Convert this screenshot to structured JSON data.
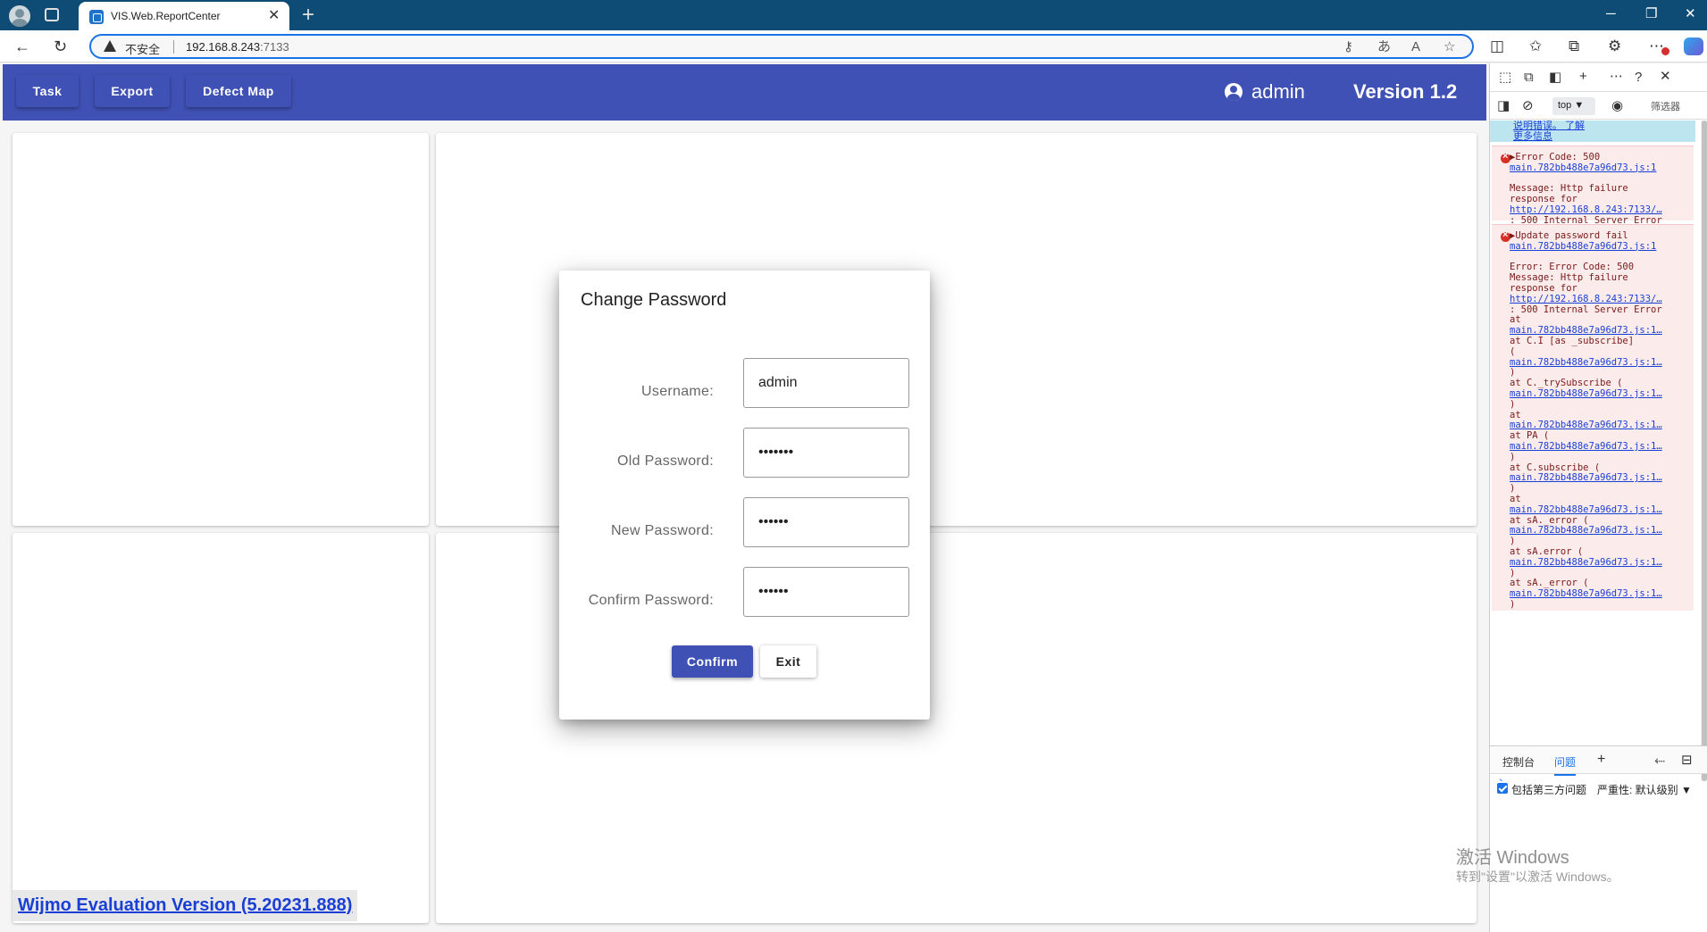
{
  "browser": {
    "tab_title": "VIS.Web.ReportCenter",
    "tab_close": "✕",
    "new_tab": "+",
    "win_min": "─",
    "win_max": "❐",
    "win_close": "✕",
    "insecure_label": "不安全",
    "url_host": "192.168.8.243",
    "url_port": ":7133",
    "icons": [
      "back-icon",
      "refresh-icon",
      "warning-icon",
      "key-icon",
      "translate-icon",
      "read-aloud-icon",
      "favorite-icon",
      "split-screen-icon",
      "favorites-icon",
      "collections-icon",
      "extensions-icon",
      "more-icon",
      "copilot-icon"
    ]
  },
  "app": {
    "nav": [
      {
        "label": "Task"
      },
      {
        "label": "Export"
      },
      {
        "label": "Defect Map"
      }
    ],
    "user": "admin",
    "version": "Version 1.2",
    "wijmo_link": "Wijmo Evaluation Version (5.20231.888)",
    "colors": {
      "primary": "#3f51b5",
      "link": "#1a3fd6"
    }
  },
  "modal": {
    "title": "Change Password",
    "fields": [
      {
        "label": "Username:",
        "value": "admin",
        "type": "text"
      },
      {
        "label": "Old Password:",
        "value": "•••••••",
        "type": "password"
      },
      {
        "label": "New Password:",
        "value": "••••••",
        "type": "password"
      },
      {
        "label": "Confirm Password:",
        "value": "••••••",
        "type": "password"
      }
    ],
    "confirm_label": "Confirm",
    "exit_label": "Exit"
  },
  "devtools": {
    "context": "top ▼",
    "filter": "筛选器",
    "info_line1": "说明错误。 了解",
    "info_line2": "更多信息",
    "errors": [
      {
        "lines": [
          {
            "text": "▶Error Code: 500",
            "link": false
          },
          {
            "text": " main.782bb488e7a96d73.js:1",
            "link": true
          },
          {
            "text": "",
            "link": false
          },
          {
            "text": "Message: Http failure",
            "link": false
          },
          {
            "text": "response for",
            "link": false
          },
          {
            "text": "http://192.168.8.243:7133/…",
            "link": true
          },
          {
            "text": ": 500 Internal Server Error",
            "link": false
          }
        ]
      },
      {
        "lines": [
          {
            "text": "▶Update password fail",
            "link": false
          },
          {
            "text": " main.782bb488e7a96d73.js:1",
            "link": true
          },
          {
            "text": "",
            "link": false
          },
          {
            "text": "Error: Error Code: 500",
            "link": false
          },
          {
            "text": "Message: Http failure",
            "link": false
          },
          {
            "text": "response for",
            "link": false
          },
          {
            "text": "http://192.168.8.243:7133/…",
            "link": true
          },
          {
            "text": ": 500 Internal Server Error",
            "link": false
          },
          {
            "text": "    at",
            "link": false
          },
          {
            "text": "main.782bb488e7a96d73.js:1…",
            "link": true
          },
          {
            "text": "    at C.I [as _subscribe]",
            "link": false
          },
          {
            "text": "(",
            "link": false
          },
          {
            "text": "main.782bb488e7a96d73.js:1…",
            "link": true
          },
          {
            "text": ")",
            "link": false
          },
          {
            "text": "    at C._trySubscribe (",
            "link": false
          },
          {
            "text": "main.782bb488e7a96d73.js:1…",
            "link": true
          },
          {
            "text": ")",
            "link": false
          },
          {
            "text": "    at",
            "link": false
          },
          {
            "text": "main.782bb488e7a96d73.js:1…",
            "link": true
          },
          {
            "text": "    at PA (",
            "link": false
          },
          {
            "text": "main.782bb488e7a96d73.js:1…",
            "link": true
          },
          {
            "text": ")",
            "link": false
          },
          {
            "text": "    at C.subscribe (",
            "link": false
          },
          {
            "text": "main.782bb488e7a96d73.js:1…",
            "link": true
          },
          {
            "text": ")",
            "link": false
          },
          {
            "text": "    at",
            "link": false
          },
          {
            "text": "main.782bb488e7a96d73.js:1…",
            "link": true
          },
          {
            "text": "    at sA._error (",
            "link": false
          },
          {
            "text": "main.782bb488e7a96d73.js:1…",
            "link": true
          },
          {
            "text": ")",
            "link": false
          },
          {
            "text": "    at sA.error (",
            "link": false
          },
          {
            "text": "main.782bb488e7a96d73.js:1…",
            "link": true
          },
          {
            "text": ")",
            "link": false
          },
          {
            "text": "    at sA._error (",
            "link": false
          },
          {
            "text": "main.782bb488e7a96d73.js:1…",
            "link": true
          },
          {
            "text": ")",
            "link": false
          }
        ]
      }
    ],
    "prompt": "›",
    "drawer_tabs": [
      "控制台",
      "问题"
    ],
    "drawer_add": "+",
    "include_third_party": "包括第三方问题",
    "severity": "严重性: 默认级别 ▼"
  },
  "windows_watermark": {
    "line1": "激活 Windows",
    "line2": "转到\"设置\"以激活 Windows。"
  }
}
